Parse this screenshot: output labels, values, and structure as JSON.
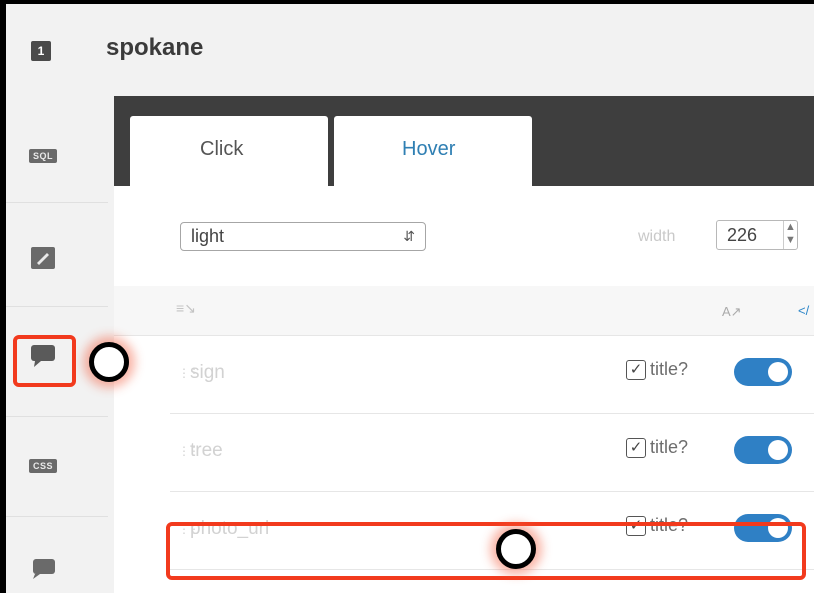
{
  "header": {
    "layer_number": "1",
    "layer_name": "spokane"
  },
  "rail": {
    "items": [
      {
        "name": "sql-icon",
        "label": "SQL"
      },
      {
        "name": "wizard-icon",
        "label": ""
      },
      {
        "name": "infowindow-icon",
        "label": ""
      },
      {
        "name": "css-icon",
        "label": "CSS"
      },
      {
        "name": "legend-icon",
        "label": ""
      }
    ]
  },
  "tabs": [
    {
      "label": "Click",
      "active": true
    },
    {
      "label": "Hover",
      "active": false
    }
  ],
  "toolbar": {
    "theme_value": "light",
    "width_label": "width",
    "width_value": "226"
  },
  "subbar": {
    "sort_label": "A↗",
    "code_label": "</"
  },
  "fields": [
    {
      "name": "sign",
      "title_label": "title?",
      "title_checked": true,
      "enabled": true
    },
    {
      "name": "tree",
      "title_label": "title?",
      "title_checked": true,
      "enabled": true
    },
    {
      "name": "photo_url",
      "title_label": "title?",
      "title_checked": true,
      "enabled": true
    }
  ],
  "colors": {
    "accent": "#2f80c5",
    "highlight": "#f23a1d",
    "tabbar": "#3e3e3e"
  }
}
